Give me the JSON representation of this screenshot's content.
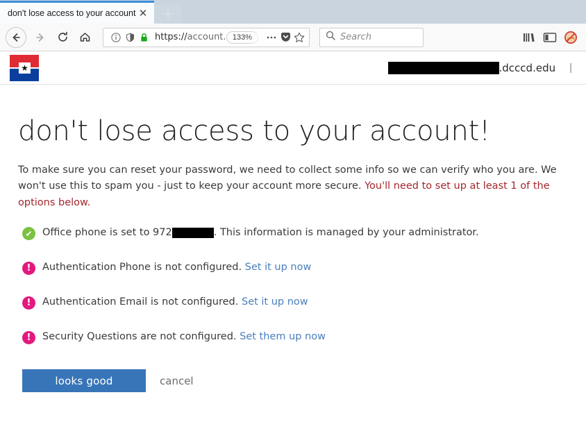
{
  "browser": {
    "tab": {
      "title": "don't lose access to your account!",
      "close_label": "✕"
    },
    "newtab_label": "+",
    "nav": {
      "back_icon": "back-arrow-icon",
      "forward_icon": "forward-arrow-icon",
      "reload_icon": "reload-icon",
      "home_icon": "home-icon"
    },
    "url": {
      "scheme": "https://",
      "host_visible": "account.activ",
      "full_visible": "https://account.activ",
      "zoom_level": "133%",
      "page_info_icon": "info-icon",
      "tracking_icon": "shield-icon",
      "lock_icon": "padlock-icon",
      "more_icon": "ellipsis-icon",
      "pocket_icon": "pocket-icon",
      "bookmark_icon": "star-icon"
    },
    "search": {
      "placeholder": "Search",
      "icon": "search-icon"
    },
    "toolbar_right": {
      "library_icon": "library-icon",
      "sidebar_icon": "sidebar-icon",
      "account_icon": "blocked-account-icon"
    }
  },
  "page": {
    "logo_name": "dcccd-star-logo",
    "header": {
      "redacted_user": "",
      "domain": ".dcccd.edu",
      "divider": "|"
    },
    "title": "don't lose access to your account!",
    "intro": {
      "part1": "To make sure you can reset your password, we need to collect some info so we can verify who you are. We won't use this to spam you - just to keep your account more secure. ",
      "warning": "You'll need to set up at least 1 of the options below."
    },
    "rows": [
      {
        "icon": "check-circle-icon",
        "state": "ok",
        "glyph": "✔",
        "text_before": "Office phone is set to 972",
        "redacted": true,
        "text_after": ". This information is managed by your administrator.",
        "link": ""
      },
      {
        "icon": "alert-circle-icon",
        "state": "warn",
        "glyph": "!",
        "text_before": "Authentication Phone is not configured. ",
        "redacted": false,
        "text_after": "",
        "link": "Set it up now"
      },
      {
        "icon": "alert-circle-icon",
        "state": "warn",
        "glyph": "!",
        "text_before": "Authentication Email is not configured. ",
        "redacted": false,
        "text_after": "",
        "link": "Set it up now"
      },
      {
        "icon": "alert-circle-icon",
        "state": "warn",
        "glyph": "!",
        "text_before": "Security Questions are not configured. ",
        "redacted": false,
        "text_after": "",
        "link": "Set them up now"
      }
    ],
    "actions": {
      "primary": "looks good",
      "cancel": "cancel"
    },
    "colors": {
      "primary_button": "#3875b8",
      "warning_text": "#a4262c",
      "link": "#4a7ebb",
      "ok_icon": "#7cc142",
      "alert_icon": "#e3197f",
      "logo_red": "#e02b35",
      "logo_blue": "#0b3f9e"
    }
  }
}
